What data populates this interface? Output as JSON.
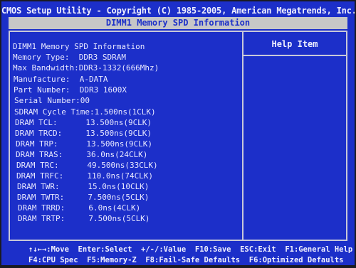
{
  "title": "CMOS Setup Utility - Copyright (C) 1985-2005, American Megatrends, Inc.",
  "subtitle": "DIMM1 Memory SPD Information",
  "help_header": "Help Item",
  "info": {
    "heading": "DIMM1 Memory SPD Information",
    "memory_type": "Memory Type:  DDR3 SDRAM",
    "max_bandwidth": "Max Bandwidth:DDR3-1332(666Mhz)",
    "manufacture": "Manufacture:  A-DATA",
    "part_number": "Part Number:  DDR3 1600X",
    "serial_number": "Serial Number:00",
    "cycle_time": "SDRAM Cycle Time:1.500ns(1CLK)",
    "dram_tcl": "DRAM TCL:      13.500ns(9CLK)",
    "dram_trcd": "DRAM TRCD:     13.500ns(9CLK)",
    "dram_trp": "DRAM TRP:      13.500ns(9CLK)",
    "dram_tras": "DRAM TRAS:     36.0ns(24CLK)",
    "dram_trc": "DRAM TRC:      49.500ns(33CLK)",
    "dram_trfc": "DRAM TRFC:     110.0ns(74CLK)",
    "dram_twr": "DRAM TWR:      15.0ns(10CLK)",
    "dram_twtr": "DRAM TWTR:     7.500ns(5CLK)",
    "dram_trrd": "DRAM TRRD:     6.0ns(4CLK)",
    "dram_trtp": "DRAM TRTP:     7.500ns(5CLK)"
  },
  "footer": {
    "line1": "↑↓←→:Move  Enter:Select  +/-/:Value  F10:Save  ESC:Exit  F1:General Help",
    "line2": "F4:CPU Spec  F5:Memory-Z  F8:Fail-Safe Defaults  F6:Optimized Defaults"
  },
  "colors": {
    "background": "#1c2fc9",
    "subtitle_bar": "#c7c7c7",
    "text": "#e8e8ff"
  }
}
